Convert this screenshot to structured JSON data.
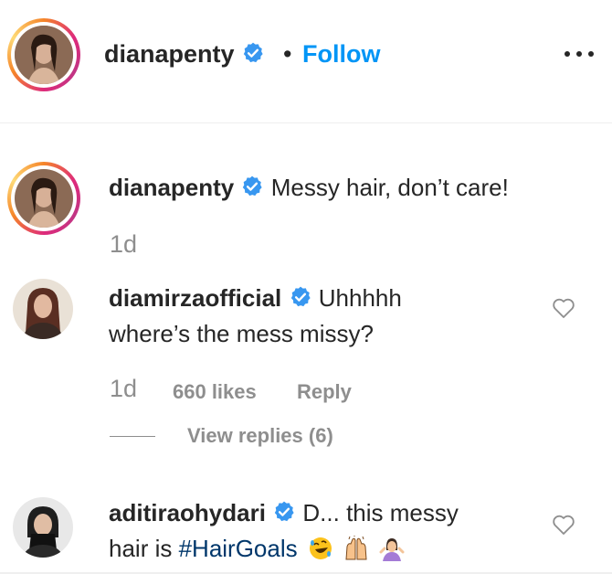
{
  "header": {
    "username": "dianapenty",
    "separator": "•",
    "follow_label": "Follow"
  },
  "caption": {
    "username": "dianapenty",
    "text": "Messy hair, don’t care!",
    "time": "1d"
  },
  "comments": [
    {
      "username": "diamirzaofficial",
      "text_line1": "Uhhhhh",
      "text_line2": "where’s the mess missy?",
      "time": "1d",
      "likes": "660 likes",
      "reply_label": "Reply",
      "view_replies": "View replies (6)"
    },
    {
      "username": "aditiraohydari",
      "text_line1": "D... this messy",
      "text_line2_prefix": "hair is ",
      "hashtag": "#HairGoals",
      "emojis": [
        "rofl-emoji",
        "raising-hands-emoji",
        "shrug-woman-emoji"
      ]
    }
  ],
  "colors": {
    "accent": "#0095f6",
    "verified": "#3897f0",
    "muted": "#8e8e8e",
    "hashtag": "#00376b"
  }
}
